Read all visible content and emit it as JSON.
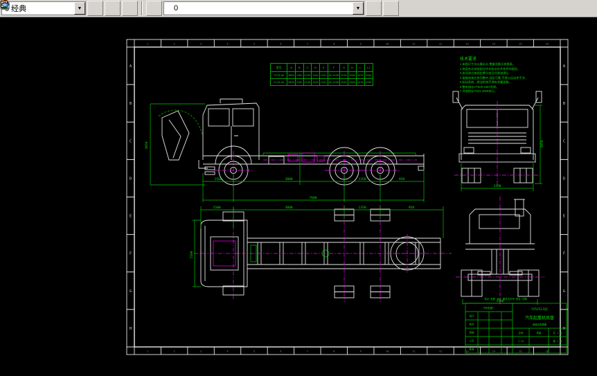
{
  "toolbar": {
    "style_combo_value": "0 经典",
    "layer_combo_value": "0",
    "layer_combo_icons": [
      "lightbulb",
      "sun",
      "lock",
      "color-swatch"
    ]
  },
  "frame": {
    "zones": [
      "A",
      "B",
      "C",
      "D",
      "E",
      "F",
      "G",
      "H"
    ],
    "columns": [
      "1",
      "2",
      "3",
      "4",
      "5",
      "6",
      "7",
      "8",
      "9",
      "10",
      "11",
      "12",
      "13",
      "14",
      "15",
      "16"
    ]
  },
  "spec_table": {
    "headers": [
      "型号",
      "A",
      "B",
      "C",
      "D",
      "E",
      "F",
      "G",
      "H",
      "L",
      "L1"
    ],
    "rows": [
      [
        "YZ75-50",
        "3800",
        "1150",
        "1190",
        "1145",
        "1310",
        "AC1438",
        "2042",
        "≥350",
        "≤475",
        "≤334"
      ],
      [
        "YL10-50",
        "3800",
        "1190",
        "1190",
        "1145",
        "1310",
        "AC1438",
        "2042",
        "≥350",
        "≤475",
        "≤334"
      ]
    ]
  },
  "notes": {
    "title": "技术要求",
    "lines": [
      "1.本图尺寸均以毫米计,整备质量见参数表。",
      "2.底盘各总成装配应符合各自技术条件的规定。",
      "3.各润滑点按规定牌号加注润滑油(脂)。",
      "4.管路线束应排列整齐,固定可靠,不得与运动件干涉。",
      "5.制动系统、燃油系统不得有渗漏现象。",
      "6.整车按QC/T900-1997验收。",
      "7.涂漆按Q/YZ01-2000执行。"
    ]
  },
  "dims": {
    "side": [
      "1500",
      "3800",
      "1350",
      "950"
    ],
    "side_overall": "7600",
    "side_height": "3050",
    "front_width": "2490",
    "front_height": "3050",
    "plan": [
      "1500",
      "3800",
      "1350",
      "950"
    ],
    "plan_width": "2500",
    "rear_width": "2500"
  },
  "title_block": {
    "org": "汽车制造厂",
    "model": "YZ5251JQZ",
    "title": "汽车起重机底盘",
    "subtitle": "底盘总布置图",
    "rows": [
      "设计",
      "校对",
      "审核",
      "工艺",
      "批准"
    ],
    "scale_label": "比例",
    "scale_value": "1:15",
    "mass_label": "质量",
    "sheet1": "共 1 张",
    "sheet2": "第 1 张",
    "rev_header": "标记 处数 分区 更改文件号 签名 日期"
  }
}
